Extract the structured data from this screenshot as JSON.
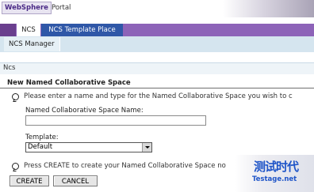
{
  "banner": {
    "logo_text": "WebSphere",
    "portal_text": "Portal"
  },
  "tabs": [
    {
      "label": "NCS",
      "active": true
    },
    {
      "label": "NCS Template Place",
      "active": false
    }
  ],
  "subnav": {
    "items": [
      "NCS Manager"
    ]
  },
  "breadcrumb": "Ncs",
  "form": {
    "section_title": "New Named Collaborative Space",
    "instruction_1": "Please enter a name and type for the Named Collaborative Space you wish to c",
    "name_label": "Named Collaborative Space Name:",
    "name_value": "",
    "template_label": "Template:",
    "template_selected": "Default",
    "instruction_2": "Press CREATE to create your Named Collaborative Space no"
  },
  "buttons": {
    "create": "CREATE",
    "cancel": "CANCEL"
  },
  "watermark": {
    "chinese": "测试时代",
    "site": "Testage.net"
  },
  "colors": {
    "tab_bar": "#8d63b8",
    "tab_active_blue": "#2f57a7",
    "subnav_bg": "#d5e5ef",
    "watermark": "#1f55c8"
  }
}
